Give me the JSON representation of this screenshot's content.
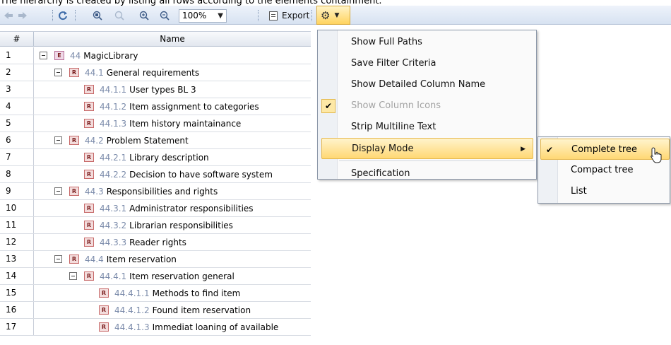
{
  "caption": "The hierarchy is created by listing all rows according to the elements containment.",
  "toolbar": {
    "icons": [
      "back-arrow-icon",
      "forward-arrow-icon",
      "refresh-icon",
      "zoom-fit-icon",
      "zoom-selection-icon",
      "zoom-in-icon",
      "zoom-out-icon",
      "gear-icon"
    ],
    "zoom_value": "100%",
    "export_label": "Export"
  },
  "grid": {
    "columns": [
      "#",
      "Name"
    ],
    "rows": [
      {
        "n": "1",
        "indent": 0,
        "toggle": true,
        "type": "E",
        "num": "44",
        "name": "MagicLibrary"
      },
      {
        "n": "2",
        "indent": 1,
        "toggle": true,
        "type": "R",
        "num": "44.1",
        "name": "General requirements"
      },
      {
        "n": "3",
        "indent": 2,
        "toggle": false,
        "type": "R",
        "num": "44.1.1",
        "name": "User types BL 3"
      },
      {
        "n": "4",
        "indent": 2,
        "toggle": false,
        "type": "R",
        "num": "44.1.2",
        "name": "Item assignment to categories"
      },
      {
        "n": "5",
        "indent": 2,
        "toggle": false,
        "type": "R",
        "num": "44.1.3",
        "name": "Item history maintainance"
      },
      {
        "n": "6",
        "indent": 1,
        "toggle": true,
        "type": "R",
        "num": "44.2",
        "name": "Problem Statement"
      },
      {
        "n": "7",
        "indent": 2,
        "toggle": false,
        "type": "R",
        "num": "44.2.1",
        "name": "Library description"
      },
      {
        "n": "8",
        "indent": 2,
        "toggle": false,
        "type": "R",
        "num": "44.2.2",
        "name": "Decision to have software system"
      },
      {
        "n": "9",
        "indent": 1,
        "toggle": true,
        "type": "R",
        "num": "44.3",
        "name": "Responsibilities and rights"
      },
      {
        "n": "10",
        "indent": 2,
        "toggle": false,
        "type": "R",
        "num": "44.3.1",
        "name": "Administrator responsibilities"
      },
      {
        "n": "11",
        "indent": 2,
        "toggle": false,
        "type": "R",
        "num": "44.3.2",
        "name": "Librarian responsibilities"
      },
      {
        "n": "12",
        "indent": 2,
        "toggle": false,
        "type": "R",
        "num": "44.3.3",
        "name": "Reader rights"
      },
      {
        "n": "13",
        "indent": 1,
        "toggle": true,
        "type": "R",
        "num": "44.4",
        "name": "Item reservation"
      },
      {
        "n": "14",
        "indent": 2,
        "toggle": true,
        "type": "R",
        "num": "44.4.1",
        "name": "Item reservation general"
      },
      {
        "n": "15",
        "indent": 3,
        "toggle": false,
        "type": "R",
        "num": "44.4.1.1",
        "name": "Methods to find item"
      },
      {
        "n": "16",
        "indent": 3,
        "toggle": false,
        "type": "R",
        "num": "44.4.1.2",
        "name": "Found item reservation"
      },
      {
        "n": "17",
        "indent": 3,
        "toggle": false,
        "type": "R",
        "num": "44.4.1.3",
        "name": "Immediat loaning of available"
      }
    ]
  },
  "menu": {
    "items": [
      {
        "label": "Show Full Paths",
        "checked": false,
        "disabled": false,
        "submenu": false,
        "highlighted": false
      },
      {
        "label": "Save Filter Criteria",
        "checked": false,
        "disabled": false,
        "submenu": false,
        "highlighted": false
      },
      {
        "label": "Show Detailed Column Name",
        "checked": false,
        "disabled": false,
        "submenu": false,
        "highlighted": false
      },
      {
        "label": "Show Column Icons",
        "checked": true,
        "disabled": true,
        "submenu": false,
        "highlighted": false
      },
      {
        "label": "Strip Multiline Text",
        "checked": false,
        "disabled": false,
        "submenu": false,
        "highlighted": false
      },
      {
        "label": "Display Mode",
        "checked": false,
        "disabled": false,
        "submenu": true,
        "highlighted": true
      },
      {
        "label": "Specification",
        "checked": false,
        "disabled": false,
        "submenu": false,
        "highlighted": false
      }
    ]
  },
  "submenu": {
    "items": [
      {
        "label": "Complete tree",
        "checked": true,
        "highlighted": true
      },
      {
        "label": "Compact tree",
        "checked": false,
        "highlighted": false
      },
      {
        "label": "List",
        "checked": false,
        "highlighted": false
      }
    ]
  }
}
